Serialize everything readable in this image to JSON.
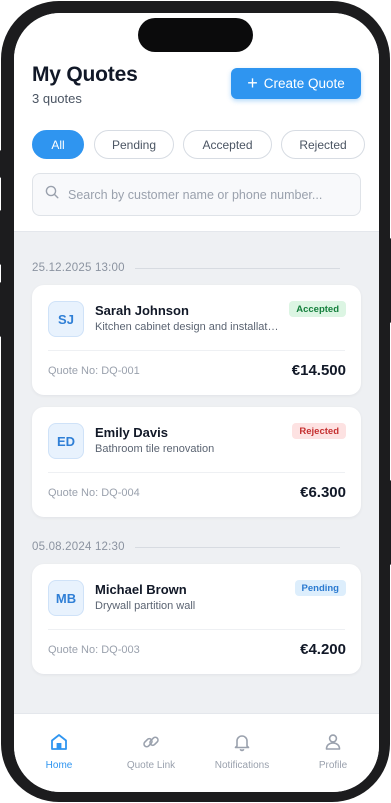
{
  "header": {
    "title": "My Quotes",
    "count": "3 quotes",
    "create_label": "Create Quote"
  },
  "filters": [
    {
      "label": "All",
      "active": true
    },
    {
      "label": "Pending",
      "active": false
    },
    {
      "label": "Accepted",
      "active": false
    },
    {
      "label": "Rejected",
      "active": false
    }
  ],
  "search": {
    "placeholder": "Search by customer name or phone number...",
    "value": ""
  },
  "groups": [
    {
      "date": "25.12.2025 13:00",
      "quotes": [
        {
          "initials": "SJ",
          "name": "Sarah Johnson",
          "description": "Kitchen cabinet design and installation",
          "status": "Accepted",
          "quote_no": "Quote No: DQ-001",
          "amount": "€14.500"
        },
        {
          "initials": "ED",
          "name": "Emily Davis",
          "description": "Bathroom tile renovation",
          "status": "Rejected",
          "quote_no": "Quote No: DQ-004",
          "amount": "€6.300"
        }
      ]
    },
    {
      "date": "05.08.2024 12:30",
      "quotes": [
        {
          "initials": "MB",
          "name": "Michael Brown",
          "description": "Drywall partition wall",
          "status": "Pending",
          "quote_no": "Quote No: DQ-003",
          "amount": "€4.200"
        }
      ]
    }
  ],
  "nav": [
    {
      "label": "Home",
      "icon": "home-icon",
      "active": true
    },
    {
      "label": "Quote Link",
      "icon": "link-icon",
      "active": false
    },
    {
      "label": "Notifications",
      "icon": "bell-icon",
      "active": false
    },
    {
      "label": "Profile",
      "icon": "user-icon",
      "active": false
    }
  ],
  "colors": {
    "accent": "#2f95f0",
    "accepted": "#15803d",
    "rejected": "#c53030",
    "pending": "#2b7ad0"
  }
}
